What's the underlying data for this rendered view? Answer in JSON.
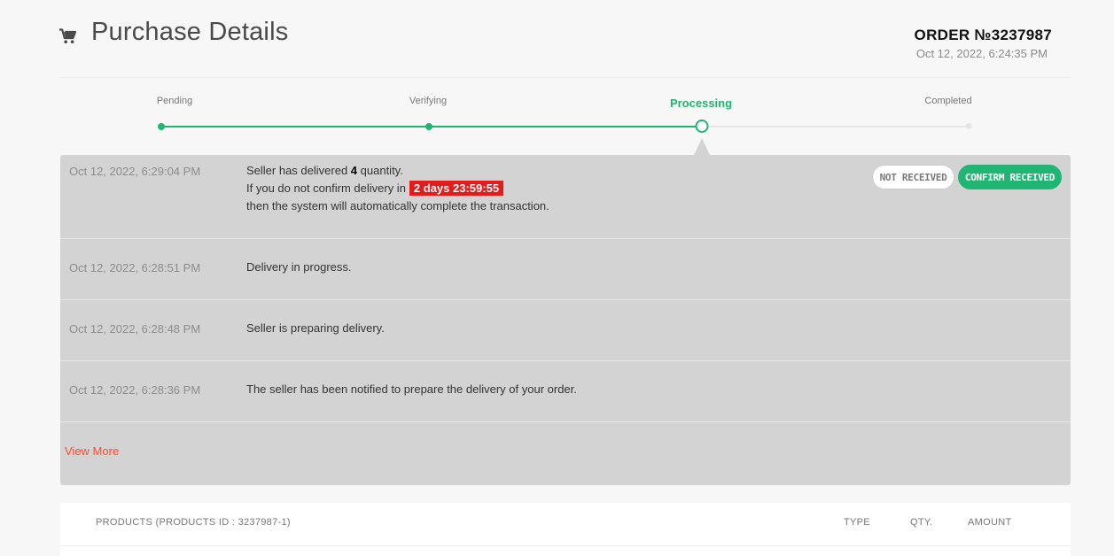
{
  "header": {
    "title": "Purchase Details",
    "cart_icon": "shopping-cart-icon",
    "order_number": "ORDER №3237987",
    "order_date": "Oct 12, 2022, 6:24:35 PM"
  },
  "stepper": {
    "steps": [
      {
        "label": "Pending",
        "state": "done"
      },
      {
        "label": "Verifying",
        "state": "done"
      },
      {
        "label": "Processing",
        "state": "current"
      },
      {
        "label": "Completed",
        "state": "todo"
      }
    ],
    "colors": {
      "done": "#21b573",
      "todo": "#e6e6e6"
    }
  },
  "timeline": {
    "events": [
      {
        "time": "Oct 12, 2022, 6:29:04 PM",
        "line1_prefix": "Seller has delivered ",
        "line1_qty": "4",
        "line1_suffix": " quantity.",
        "line2_prefix": "If you do not confirm delivery in",
        "countdown": "2 days 23:59:55",
        "line3": "then the system will automatically complete the transaction."
      },
      {
        "time": "Oct 12, 2022, 6:28:51 PM",
        "text": "Delivery in progress."
      },
      {
        "time": "Oct 12, 2022, 6:28:48 PM",
        "text": "Seller is preparing delivery."
      },
      {
        "time": "Oct 12, 2022, 6:28:36 PM",
        "text": "The seller has been notified to prepare the delivery of your order."
      }
    ],
    "buttons": {
      "not_received": "Not Received",
      "confirm_received": "Confirm Received"
    },
    "view_more": "View More"
  },
  "products": {
    "columns": {
      "products": "PRODUCTS (PRODUCTS ID : 3237987-1)",
      "type": "TYPE",
      "qty": "QTY.",
      "amount": "AMOUNT"
    }
  },
  "colors": {
    "accent": "#21b573",
    "countdown_bg": "#e21b1b",
    "link": "#ff4a2d"
  }
}
